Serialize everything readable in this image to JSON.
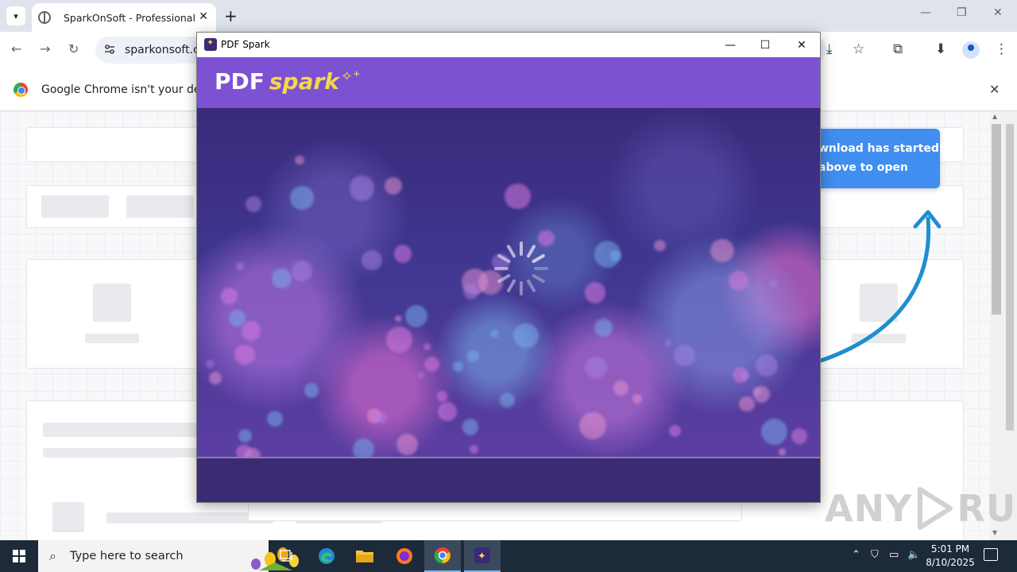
{
  "browser": {
    "tab_title": "SparkOnSoft - Professional PDF",
    "new_tab_label": "+",
    "url": "sparkonsoft.co",
    "window_controls": {
      "minimize": "—",
      "restore": "❐",
      "close": "✕"
    },
    "nav": {
      "back": "←",
      "forward": "→",
      "reload": "↻"
    }
  },
  "infobar": {
    "text": "Google Chrome isn't your default",
    "close": "✕"
  },
  "page": {
    "toast_line1": "wnload has started!",
    "toast_line2": "above to open",
    "watermark_left": "ANY",
    "watermark_right": "RUN"
  },
  "app_window": {
    "title": "PDF Spark",
    "controls": {
      "minimize": "—",
      "maximize": "☐",
      "close": "✕"
    },
    "brand_pdf": "PDF",
    "brand_spark": "spark",
    "brand_stars": "✧⁺"
  },
  "taskbar": {
    "search_placeholder": "Type here to search",
    "time": "5:01 PM",
    "date": "8/10/2025",
    "colors": {
      "background": "#1c2a3a",
      "active_indicator": "#7cb4f0"
    }
  },
  "colors": {
    "app_header": "#7c52d3",
    "brand_accent": "#f4d84a",
    "toast": "#3f8ef0",
    "app_footer": "#3a2b73"
  }
}
